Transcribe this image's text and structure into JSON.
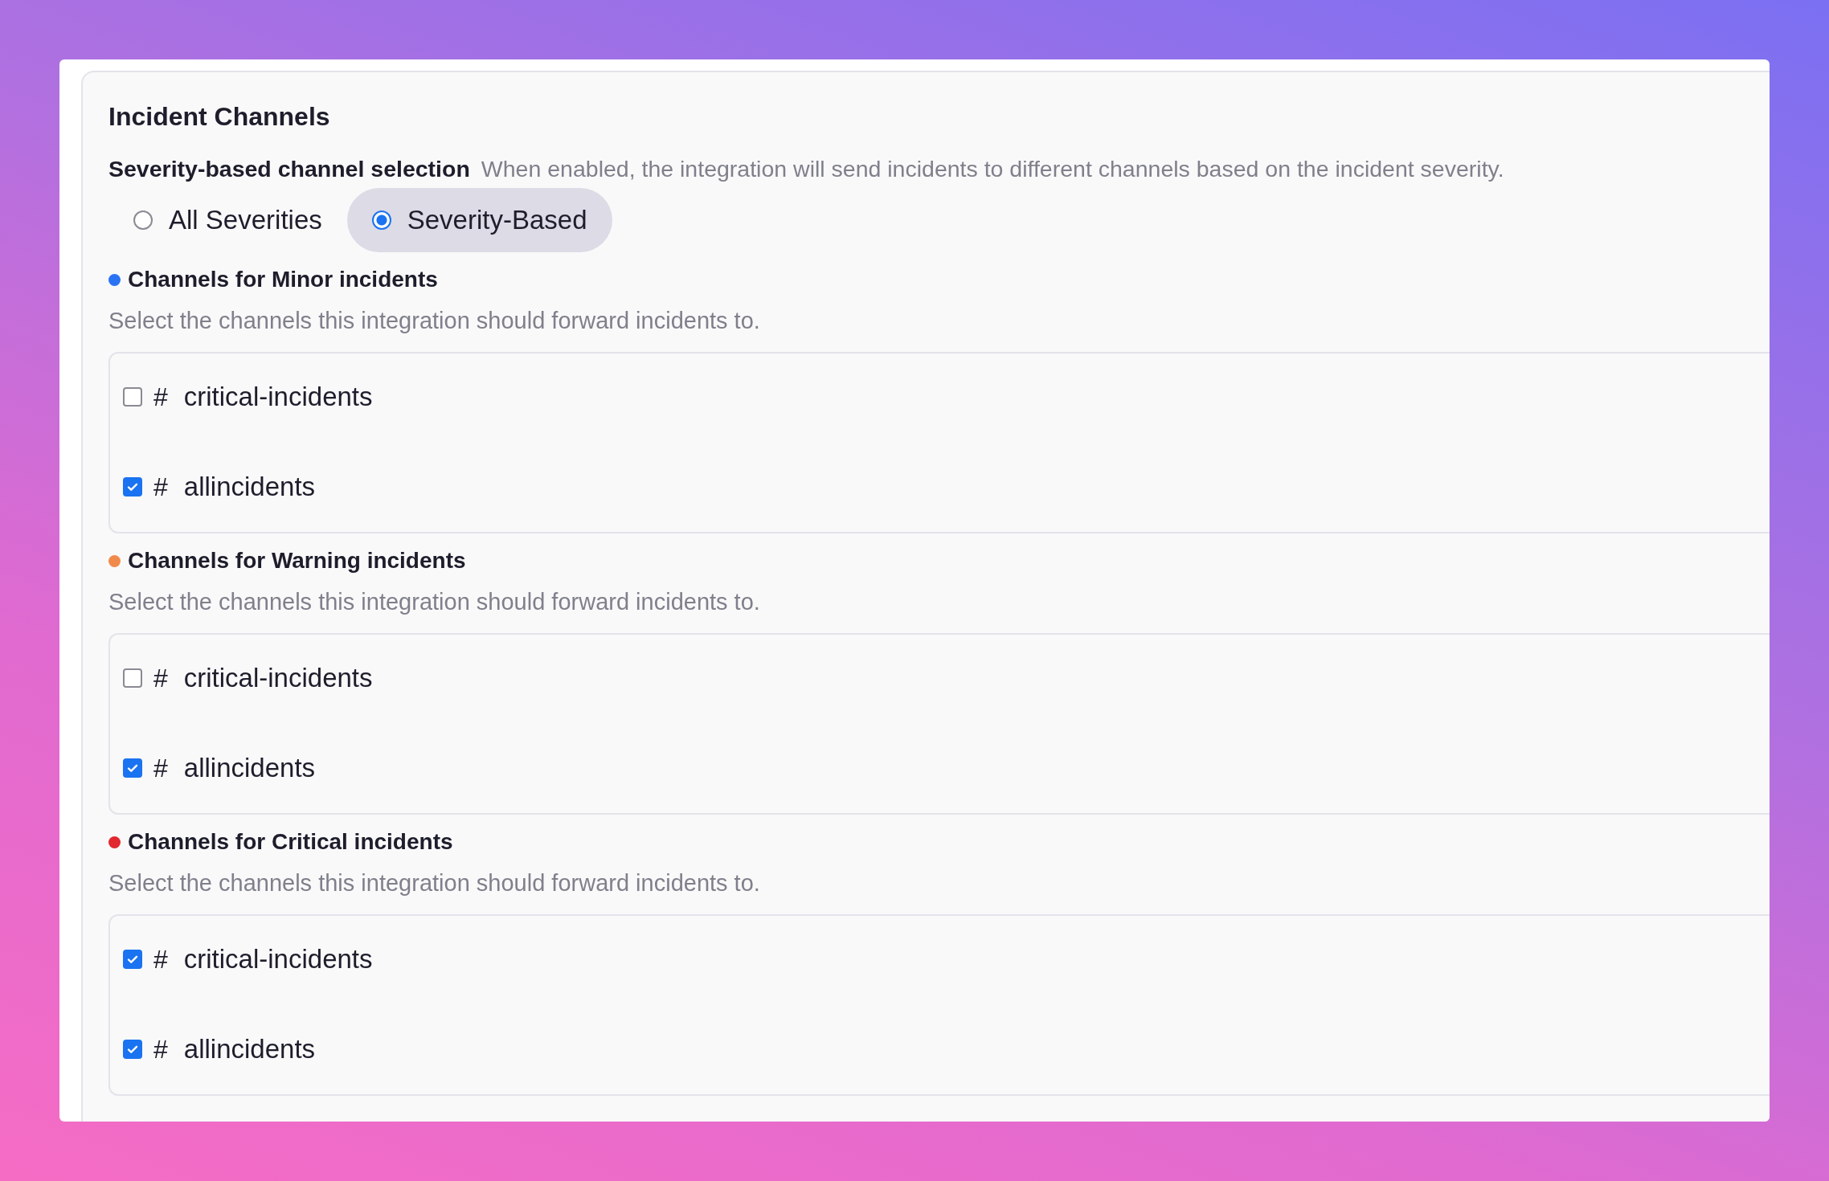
{
  "section": {
    "title": "Incident Channels"
  },
  "selection": {
    "label": "Severity-based channel selection",
    "description": "When enabled, the integration will send incidents to different channels based on the incident severity."
  },
  "modes": [
    {
      "label": "All Severities",
      "selected": false
    },
    {
      "label": "Severity-Based",
      "selected": true
    }
  ],
  "severities": [
    {
      "title": "Channels for Minor incidents",
      "color": "#2a73f5",
      "hint": "Select the channels this integration should forward incidents to.",
      "channels": [
        {
          "prefix": "#",
          "name": "critical-incidents",
          "checked": false
        },
        {
          "prefix": "#",
          "name": "allincidents",
          "checked": true
        }
      ]
    },
    {
      "title": "Channels for Warning incidents",
      "color": "#f08a4b",
      "hint": "Select the channels this integration should forward incidents to.",
      "channels": [
        {
          "prefix": "#",
          "name": "critical-incidents",
          "checked": false
        },
        {
          "prefix": "#",
          "name": "allincidents",
          "checked": true
        }
      ]
    },
    {
      "title": "Channels for Critical incidents",
      "color": "#e0282e",
      "hint": "Select the channels this integration should forward incidents to.",
      "channels": [
        {
          "prefix": "#",
          "name": "critical-incidents",
          "checked": true
        },
        {
          "prefix": "#",
          "name": "allincidents",
          "checked": true
        }
      ]
    }
  ]
}
